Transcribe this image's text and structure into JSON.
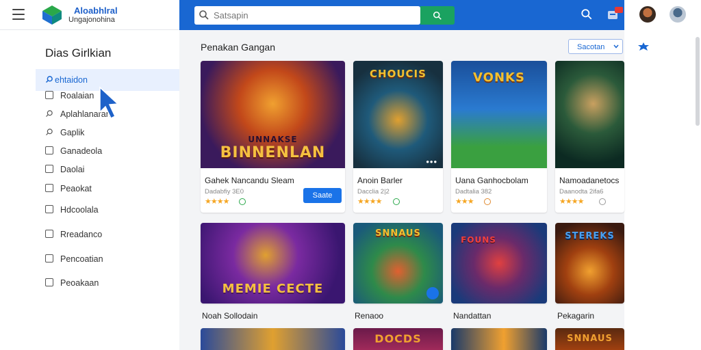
{
  "header": {
    "brand_line1": "Aloabhlral",
    "brand_line2": "Ungajonohina",
    "search_placeholder": "Satsapin"
  },
  "sidebar": {
    "title": "Dias Girlkian",
    "items": [
      {
        "label": "ehtaidon",
        "active": true
      },
      {
        "label": "Roalaian"
      },
      {
        "label": "Aplahlanaran"
      },
      {
        "label": "Gaplik"
      },
      {
        "label": "Ganadeola"
      },
      {
        "label": "Daolai"
      },
      {
        "label": "Peaokat"
      },
      {
        "label": "Hdcoolala"
      },
      {
        "label": "Rreadanco"
      },
      {
        "label": "Pencoatian"
      },
      {
        "label": "Peoakaan"
      }
    ]
  },
  "main": {
    "section_title": "Penakan Gangan",
    "sort_label": "Sacotan",
    "cards_row1": [
      {
        "title": "Gahek Nancandu Sleam",
        "meta": "Dadabfiy 3E0",
        "stars": "★★★★",
        "art_text": "BINNENLAN",
        "art_small": "UNNAKSE",
        "install_label": "Saate",
        "colors": [
          "#3a1a5c",
          "#c2481a",
          "#f0a030"
        ]
      },
      {
        "title": "Anoin Barler",
        "meta": "Dacclia 2|2",
        "stars": "★★★★",
        "art_text": "CHOUCIS",
        "colors": [
          "#17303f",
          "#1f5a7a",
          "#e0a030"
        ]
      },
      {
        "title": "Uana Ganhocbolam",
        "meta": "Dadtalia 382",
        "stars": "★★★",
        "art_text": "VONKS",
        "colors": [
          "#1a4f9a",
          "#3aa040",
          "#f2c030"
        ]
      },
      {
        "title": "Namoadanetocs",
        "meta": "Daanodta 2ifa6",
        "stars": "★★★★",
        "art_text": "",
        "colors": [
          "#0c2a22",
          "#2b5a3a",
          "#c9a060"
        ]
      }
    ],
    "cards_row2": [
      {
        "title": "Noah Sollodain",
        "art_text": "MEMIE CECTE",
        "colors": [
          "#3a1670",
          "#7a2aa0",
          "#e0a030"
        ]
      },
      {
        "title": "Renaoo",
        "art_text": "SNNAUS",
        "colors": [
          "#1a5a7a",
          "#2e8a4a",
          "#e06030"
        ]
      },
      {
        "title": "Nandattan",
        "art_text": "FOUNS",
        "colors": [
          "#1a3a7a",
          "#6a2a6a",
          "#e04040"
        ]
      },
      {
        "title": "Pekagarin",
        "art_text": "STEREKS",
        "colors": [
          "#3a1a10",
          "#a04010",
          "#f0a030"
        ]
      }
    ],
    "cards_row3": [
      {
        "colors": [
          "#2a4a9a",
          "#e0a030"
        ]
      },
      {
        "art_text": "DOCDS",
        "colors": [
          "#6a1a4a",
          "#f0a030"
        ]
      },
      {
        "colors": [
          "#1a3a6a",
          "#f0a030"
        ]
      },
      {
        "art_text": "SNNAUS",
        "colors": [
          "#5a2a10",
          "#f0a030"
        ]
      }
    ]
  }
}
